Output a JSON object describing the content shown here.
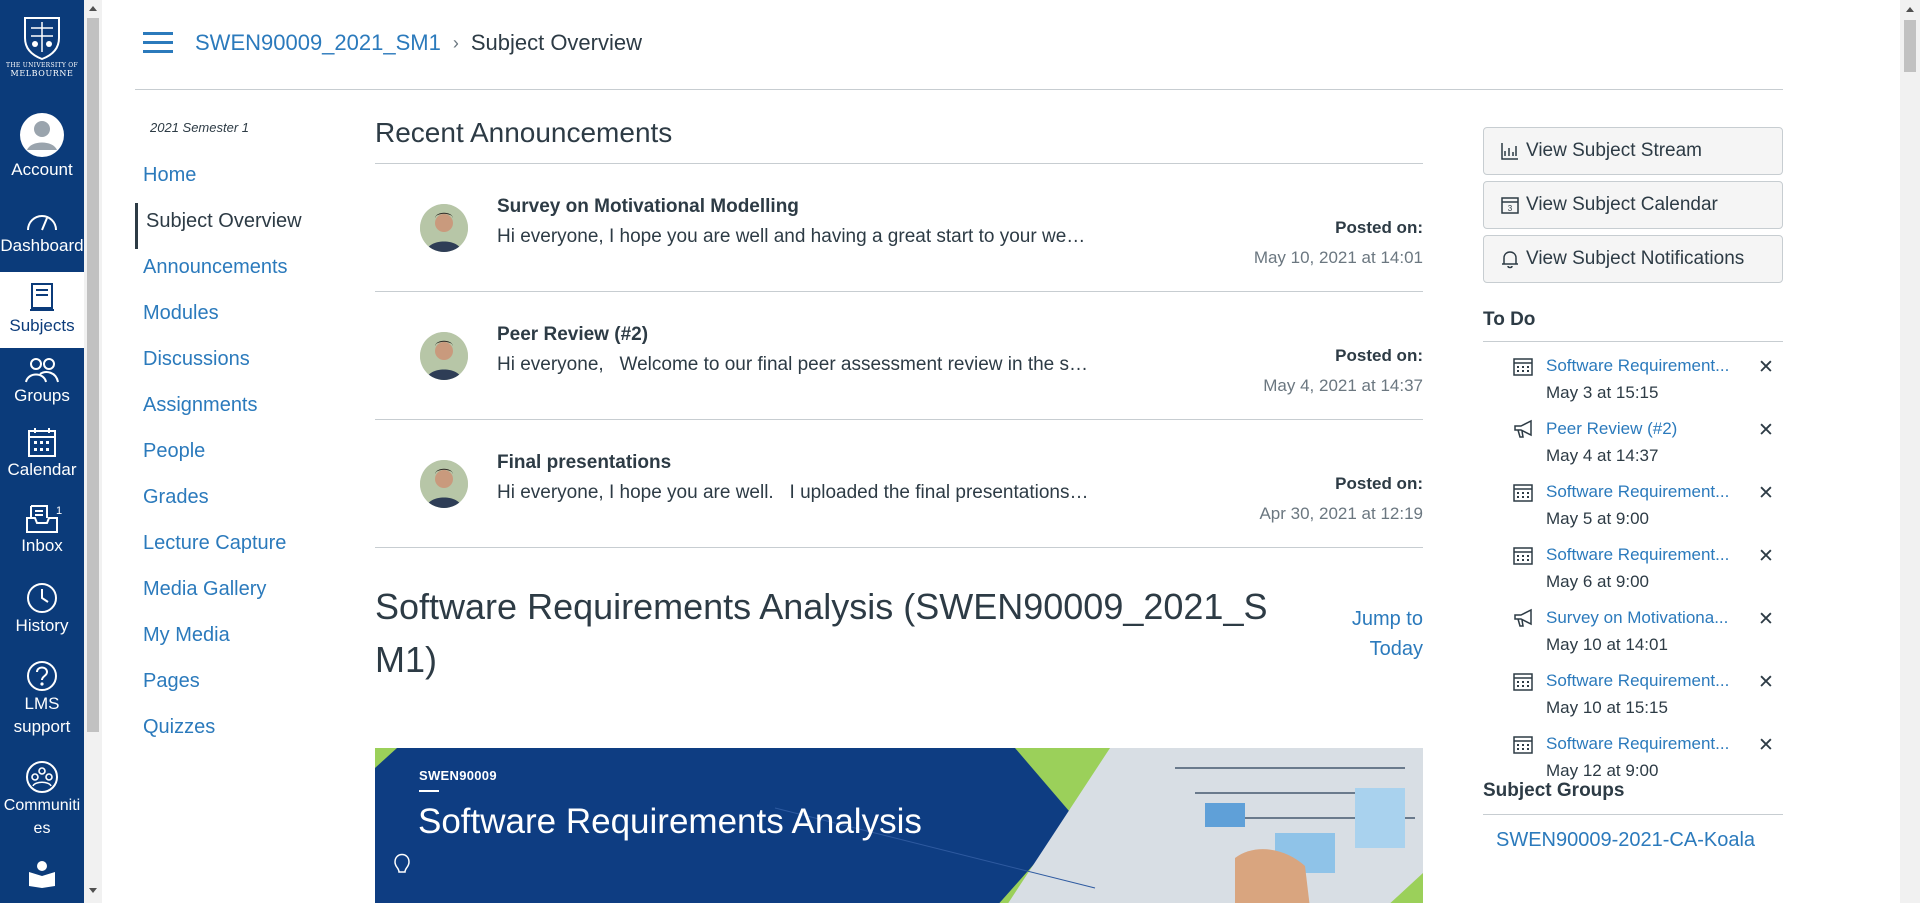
{
  "global_nav": {
    "logo_text_top": "THE UNIVERSITY OF",
    "logo_text_bottom": "MELBOURNE",
    "items": [
      {
        "label": "Account",
        "icon": "account-icon"
      },
      {
        "label": "Dashboard",
        "icon": "dashboard-icon"
      },
      {
        "label": "Subjects",
        "icon": "subjects-icon"
      },
      {
        "label": "Groups",
        "icon": "groups-icon"
      },
      {
        "label": "Calendar",
        "icon": "calendar-icon"
      },
      {
        "label": "Inbox",
        "icon": "inbox-icon",
        "badge": "1"
      },
      {
        "label": "History",
        "icon": "history-icon"
      },
      {
        "label": "LMS support",
        "line1": "LMS",
        "line2": "support",
        "icon": "help-icon"
      },
      {
        "label": "Communities",
        "line1": "Communiti",
        "line2": "es",
        "icon": "communities-icon"
      },
      {
        "label": "Library",
        "icon": "library-icon"
      }
    ]
  },
  "header": {
    "course_link": "SWEN90009_2021_SM1",
    "separator": "›",
    "current_page": "Subject Overview"
  },
  "left_menu": {
    "term": "2021 Semester 1",
    "items": [
      "Home",
      "Subject Overview",
      "Announcements",
      "Modules",
      "Discussions",
      "Assignments",
      "People",
      "Grades",
      "Lecture Capture",
      "Media Gallery",
      "My Media",
      "Pages",
      "Quizzes"
    ],
    "active": "Subject Overview"
  },
  "main": {
    "recent_heading": "Recent Announcements",
    "announcements": [
      {
        "title": "Survey on Motivational Modelling",
        "message": "Hi everyone, I hope you are well and having a great start to your we…",
        "posted_label": "Posted on:",
        "posted_date": "May 10, 2021 at 14:01"
      },
      {
        "title": "Peer Review (#2)",
        "message": "Hi everyone,   Welcome to our final peer assessment review in the s…",
        "posted_label": "Posted on:",
        "posted_date": "May 4, 2021 at 14:37"
      },
      {
        "title": "Final presentations",
        "message": "Hi everyone, I hope you are well.   I uploaded the final presentations…",
        "posted_label": "Posted on:",
        "posted_date": "Apr 30, 2021 at 12:19"
      }
    ],
    "subject_title": "Software Requirements Analysis (SWEN90009_2021_SM1)",
    "jump_line1": "Jump to",
    "jump_line2": "Today",
    "banner_code": "SWEN90009",
    "banner_name": "Software Requirements Analysis"
  },
  "right": {
    "buttons": [
      {
        "label": "View Subject Stream",
        "icon": "stream-icon"
      },
      {
        "label": "View Subject Calendar",
        "icon": "calendar-icon"
      },
      {
        "label": "View Subject Notifications",
        "icon": "bell-icon"
      }
    ],
    "todo_heading": "To Do",
    "todos": [
      {
        "title": "Software Requirement...",
        "date": "May 3 at 15:15",
        "icon": "assignment-icon"
      },
      {
        "title": "Peer Review (#2)",
        "date": "May 4 at 14:37",
        "icon": "announcement-icon"
      },
      {
        "title": "Software Requirement...",
        "date": "May 5 at 9:00",
        "icon": "assignment-icon"
      },
      {
        "title": "Software Requirement...",
        "date": "May 6 at 9:00",
        "icon": "assignment-icon"
      },
      {
        "title": "Survey on Motivationa...",
        "date": "May 10 at 14:01",
        "icon": "announcement-icon"
      },
      {
        "title": "Software Requirement...",
        "date": "May 10 at 15:15",
        "icon": "assignment-icon"
      },
      {
        "title": "Software Requirement...",
        "date": "May 12 at 9:00",
        "icon": "assignment-icon"
      }
    ],
    "dismiss_symbol": "✕",
    "groups_heading": "Subject Groups",
    "group_link": "SWEN90009-2021-CA-Koala"
  },
  "colors": {
    "nav_bg": "#0b3b7a",
    "link": "#2b7abc",
    "text": "#2d3b45",
    "banner_bg": "#0e3d82",
    "banner_accent": "#9bd05a"
  }
}
